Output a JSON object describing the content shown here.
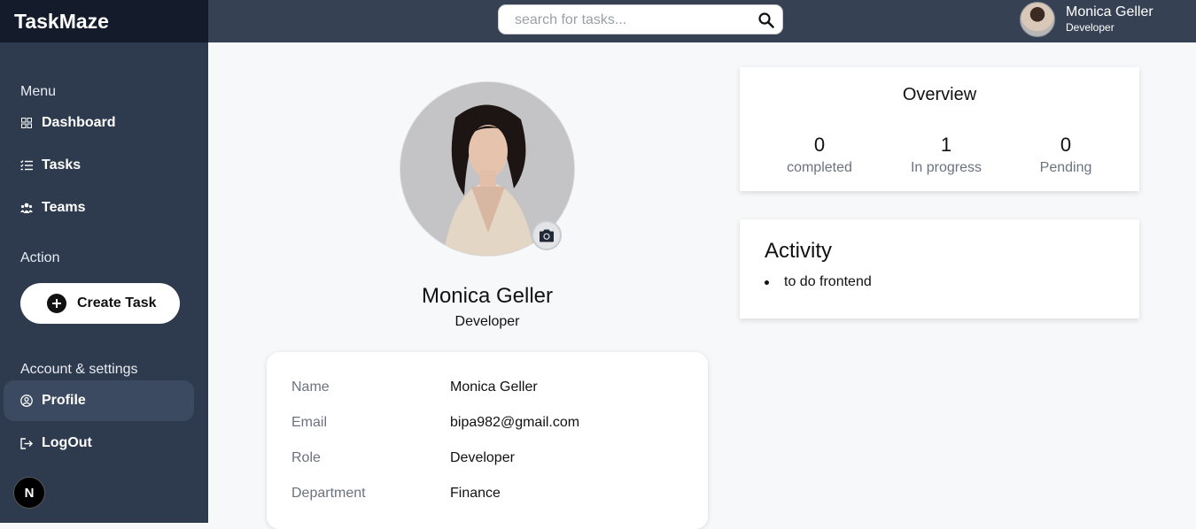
{
  "app": {
    "title": "TaskMaze"
  },
  "sidebar": {
    "menu_label": "Menu",
    "items": [
      {
        "label": "Dashboard",
        "icon": "grid-icon"
      },
      {
        "label": "Tasks",
        "icon": "list-check-icon"
      },
      {
        "label": "Teams",
        "icon": "users-icon"
      }
    ],
    "action_label": "Action",
    "create_task_label": "Create Task",
    "account_label": "Account & settings",
    "account_items": [
      {
        "label": "Profile",
        "icon": "user-circle-icon",
        "active": true
      },
      {
        "label": "LogOut",
        "icon": "logout-icon"
      }
    ],
    "n_badge": "N"
  },
  "header": {
    "search": {
      "placeholder": "search for tasks...",
      "value": ""
    },
    "user": {
      "name": "Monica Geller",
      "role": "Developer"
    }
  },
  "profile": {
    "name": "Monica Geller",
    "role": "Developer",
    "details": [
      {
        "key": "Name",
        "value": "Monica Geller"
      },
      {
        "key": "Email",
        "value": "bipa982@gmail.com"
      },
      {
        "key": "Role",
        "value": "Developer"
      },
      {
        "key": "Department",
        "value": "Finance"
      }
    ]
  },
  "overview": {
    "title": "Overview",
    "stats": [
      {
        "value": "0",
        "label": "completed"
      },
      {
        "value": "1",
        "label": "In progress"
      },
      {
        "value": "0",
        "label": "Pending"
      }
    ]
  },
  "activity": {
    "title": "Activity",
    "items": [
      "to do frontend"
    ]
  },
  "colors": {
    "sidebar_bg": "#2e3a4d",
    "brand_bg": "#141c2b",
    "topbar_bg": "#364254",
    "page_bg": "#f7f8fa"
  }
}
